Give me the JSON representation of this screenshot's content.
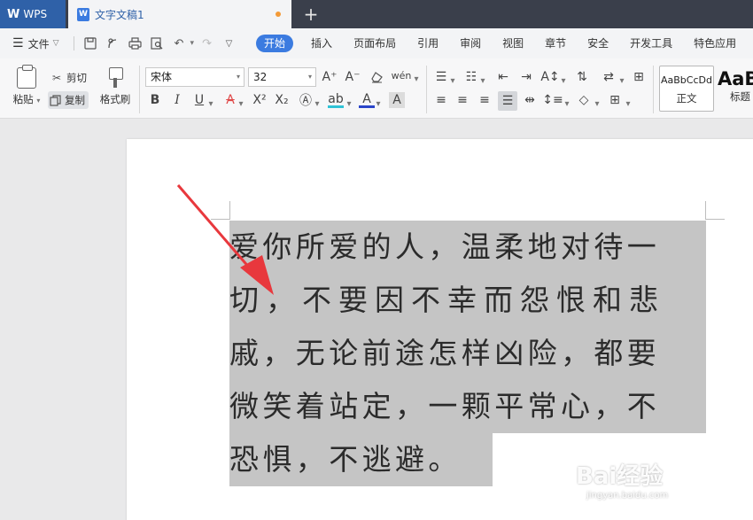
{
  "titlebar": {
    "app_name": "WPS",
    "doc_tab_title": "文字文稿1",
    "new_tab": "+"
  },
  "menubar": {
    "file_label": "文件",
    "items": [
      "开始",
      "插入",
      "页面布局",
      "引用",
      "审阅",
      "视图",
      "章节",
      "安全",
      "开发工具",
      "特色应用"
    ],
    "active_item": "开始"
  },
  "ribbon": {
    "paste_label": "粘贴",
    "cut_label": "剪切",
    "copy_label": "复制",
    "format_painter_label": "格式刷",
    "font_name": "宋体",
    "font_size": "32",
    "style_normal_preview": "AaBbCcDd",
    "style_normal_name": "正文",
    "style_heading_preview": "AaB",
    "style_heading_name": "标题"
  },
  "document": {
    "lines": [
      "爱你所爱的人，温柔地对待一",
      "切，不要因不幸而怨恨和悲",
      "戚，无论前途怎样凶险，都要",
      "微笑着站定，一颗平常心，不",
      "恐惧，不逃避。"
    ]
  },
  "watermark": {
    "main": "Bai经验",
    "sub": "jingyan.baidu.com"
  },
  "colors": {
    "accent": "#3b7be0",
    "arrow": "#e8383d",
    "selection": "#c5c5c5"
  }
}
